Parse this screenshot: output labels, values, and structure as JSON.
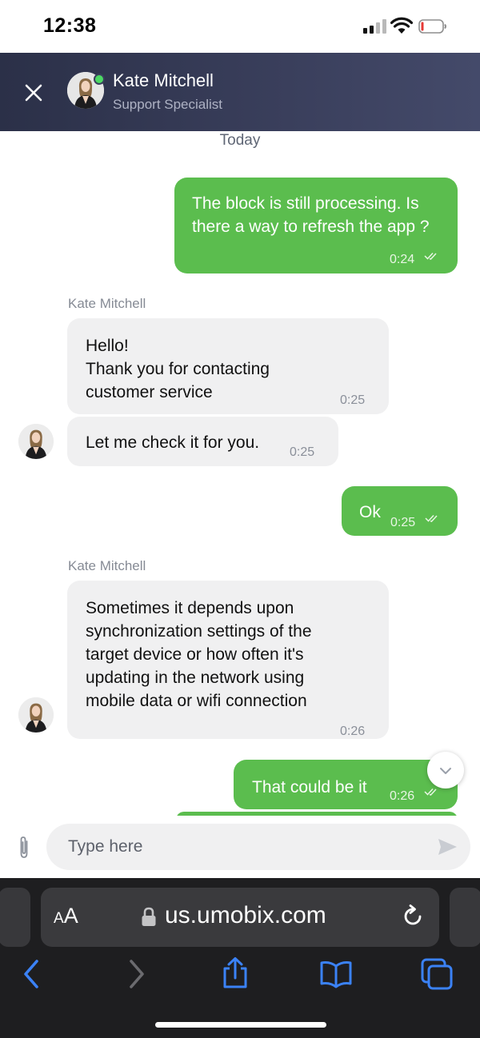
{
  "status_bar": {
    "time": "12:38"
  },
  "header": {
    "agent_name": "Kate Mitchell",
    "agent_role": "Support Specialist",
    "online_color": "#4cd964"
  },
  "chat": {
    "date_separator": "Today",
    "messages": [
      {
        "direction": "out",
        "text": "The block is still processing. Is there a way to refresh the app ?",
        "time": "0:24"
      },
      {
        "direction": "in",
        "sender": "Kate Mitchell",
        "text": "Hello!\nThank you for contacting customer service",
        "time": "0:25"
      },
      {
        "direction": "in",
        "text": "Let me check it for you.",
        "time": "0:25"
      },
      {
        "direction": "out",
        "text": "Ok",
        "time": "0:25"
      },
      {
        "direction": "in",
        "sender": "Kate Mitchell",
        "text": "Sometimes it depends upon synchronization settings of the target device or how often it's updating in the network using mobile data or wifi connection",
        "time": "0:26"
      },
      {
        "direction": "out",
        "text": "That could be it",
        "time": "0:26"
      }
    ]
  },
  "composer": {
    "placeholder": "Type here"
  },
  "browser": {
    "aa_label_small": "A",
    "aa_label_large": "A",
    "url": "us.umobix.com"
  },
  "colors": {
    "outgoing_bubble": "#5bbd4e",
    "incoming_bubble": "#f0f0f1",
    "header_bg": "#3a3f5c",
    "browser_accent": "#3b82f6"
  }
}
